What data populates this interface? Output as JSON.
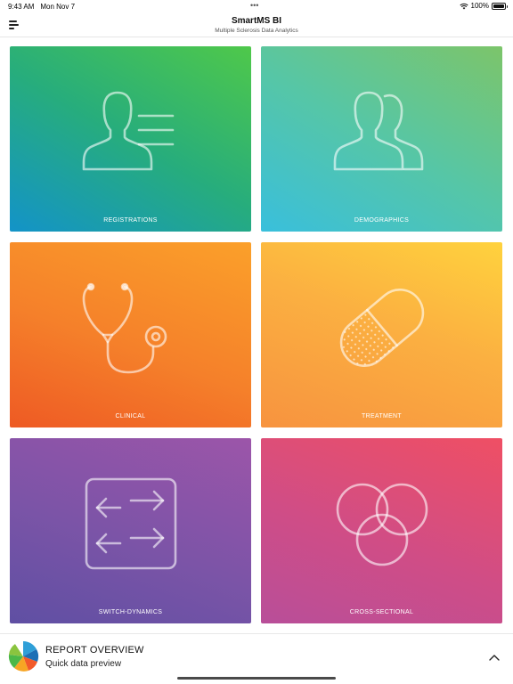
{
  "status": {
    "time": "9:43 AM",
    "date": "Mon Nov 7",
    "dots": "•••",
    "battery": "100%"
  },
  "nav": {
    "title": "SmartMS BI",
    "subtitle": "Multiple Sclerosis Data Analytics"
  },
  "tiles": [
    {
      "label": "REGISTRATIONS",
      "icon": "person-list-icon"
    },
    {
      "label": "DEMOGRAPHICS",
      "icon": "people-icon"
    },
    {
      "label": "CLINICAL",
      "icon": "stethoscope-icon"
    },
    {
      "label": "TREATMENT",
      "icon": "pill-icon"
    },
    {
      "label": "SWITCH-DYNAMICS",
      "icon": "arrows-switch-icon"
    },
    {
      "label": "CROSS-SECTIONAL",
      "icon": "venn-icon"
    }
  ],
  "bottom": {
    "title": "REPORT OVERVIEW",
    "subtitle": "Quick data preview"
  },
  "colors": {
    "registrations": [
      "#4fc84a",
      "#1393c8"
    ],
    "demographics": [
      "#7cc56a",
      "#39bfdc"
    ],
    "clinical": [
      "#fba02a",
      "#ee5a24"
    ],
    "treatment": [
      "#ffd23d",
      "#f7933f"
    ],
    "switch_dynamics": [
      "#9c55a9",
      "#5f4fa3"
    ],
    "cross_sectional": [
      "#ef4f64",
      "#b84e99"
    ]
  }
}
